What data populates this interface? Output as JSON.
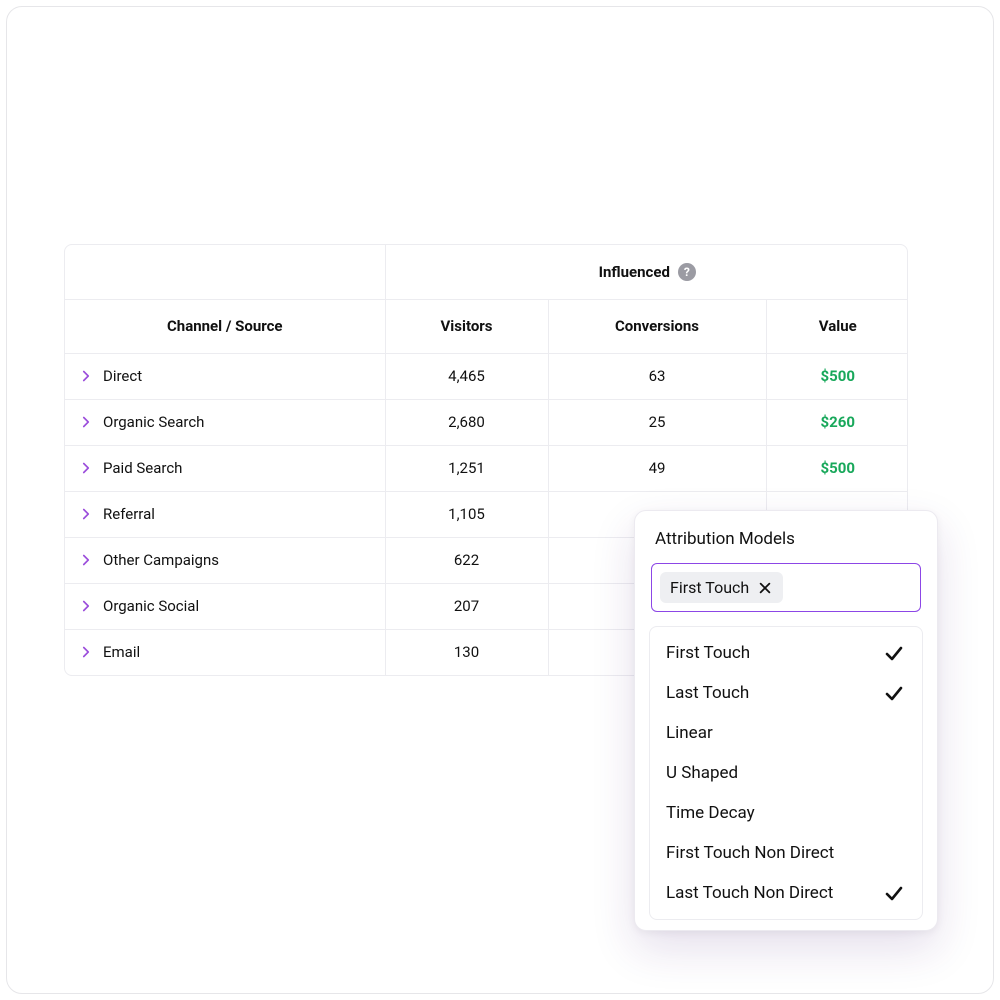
{
  "table": {
    "group_label": "Influenced",
    "headers": {
      "channel": "Channel / Source",
      "visitors": "Visitors",
      "conversions": "Conversions",
      "value": "Value"
    },
    "rows": [
      {
        "channel": "Direct",
        "visitors": "4,465",
        "conversions": "63",
        "value": "$500"
      },
      {
        "channel": "Organic Search",
        "visitors": "2,680",
        "conversions": "25",
        "value": "$260"
      },
      {
        "channel": "Paid Search",
        "visitors": "1,251",
        "conversions": "49",
        "value": "$500"
      },
      {
        "channel": "Referral",
        "visitors": "1,105",
        "conversions": "",
        "value": ""
      },
      {
        "channel": "Other Campaigns",
        "visitors": "622",
        "conversions": "",
        "value": ""
      },
      {
        "channel": "Organic Social",
        "visitors": "207",
        "conversions": "",
        "value": ""
      },
      {
        "channel": "Email",
        "visitors": "130",
        "conversions": "",
        "value": ""
      }
    ]
  },
  "panel": {
    "title": "Attribution Models",
    "selected_chip": "First Touch",
    "options": [
      {
        "label": "First Touch",
        "checked": true
      },
      {
        "label": "Last Touch",
        "checked": true
      },
      {
        "label": "Linear",
        "checked": false
      },
      {
        "label": "U Shaped",
        "checked": false
      },
      {
        "label": "Time Decay",
        "checked": false
      },
      {
        "label": "First Touch Non Direct",
        "checked": false
      },
      {
        "label": "Last Touch Non Direct",
        "checked": true
      }
    ]
  }
}
